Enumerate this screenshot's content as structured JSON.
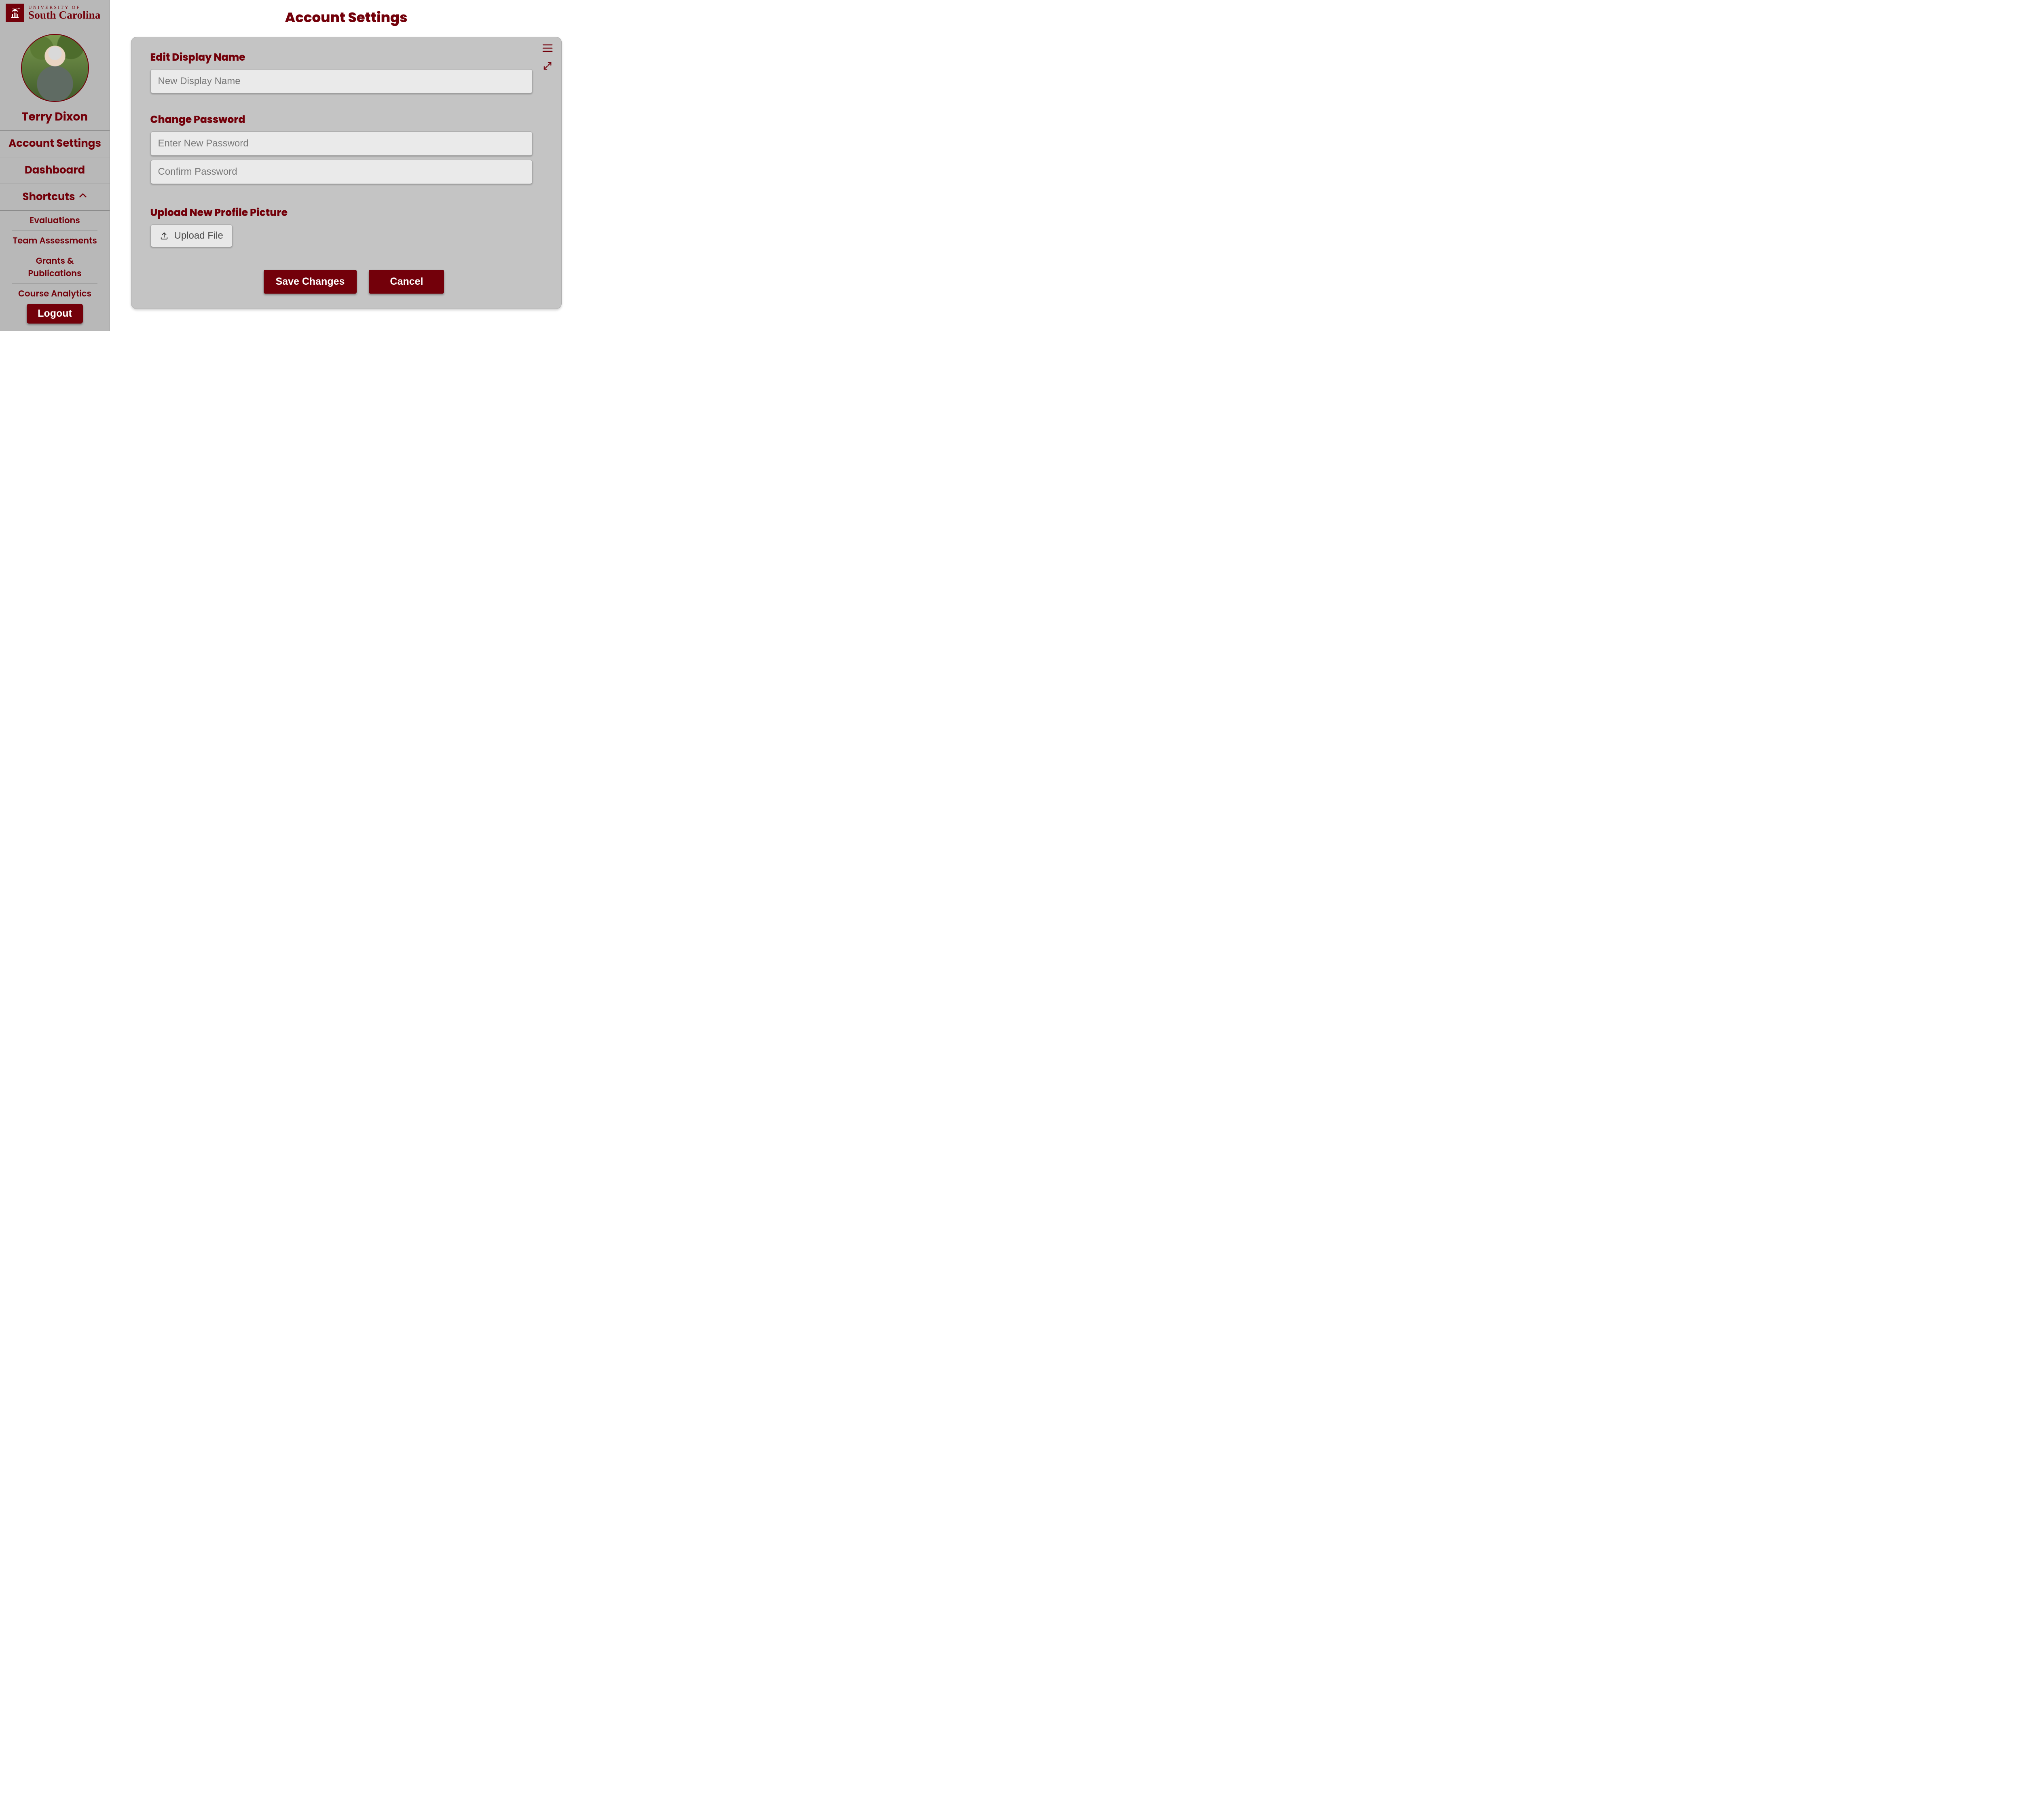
{
  "brand": {
    "university_of": "UNIVERSITY OF",
    "name": "South Carolina",
    "garnet": "#73000a"
  },
  "sidebar": {
    "user_name": "Terry Dixon",
    "nav": {
      "account_settings": "Account Settings",
      "dashboard": "Dashboard",
      "shortcuts_label": "Shortcuts"
    },
    "shortcuts": [
      "Evaluations",
      "Team Assessments",
      "Grants & Publications",
      "Course Analytics"
    ],
    "logout_label": "Logout"
  },
  "main": {
    "page_title": "Account Settings",
    "sections": {
      "display_name_label": "Edit Display Name",
      "display_name_placeholder": "New Display Name",
      "change_password_label": "Change Password",
      "new_password_placeholder": "Enter New Password",
      "confirm_password_placeholder": "Confirm Password",
      "upload_label": "Upload New Profile Picture",
      "upload_button": "Upload File"
    },
    "actions": {
      "save": "Save Changes",
      "cancel": "Cancel"
    }
  }
}
